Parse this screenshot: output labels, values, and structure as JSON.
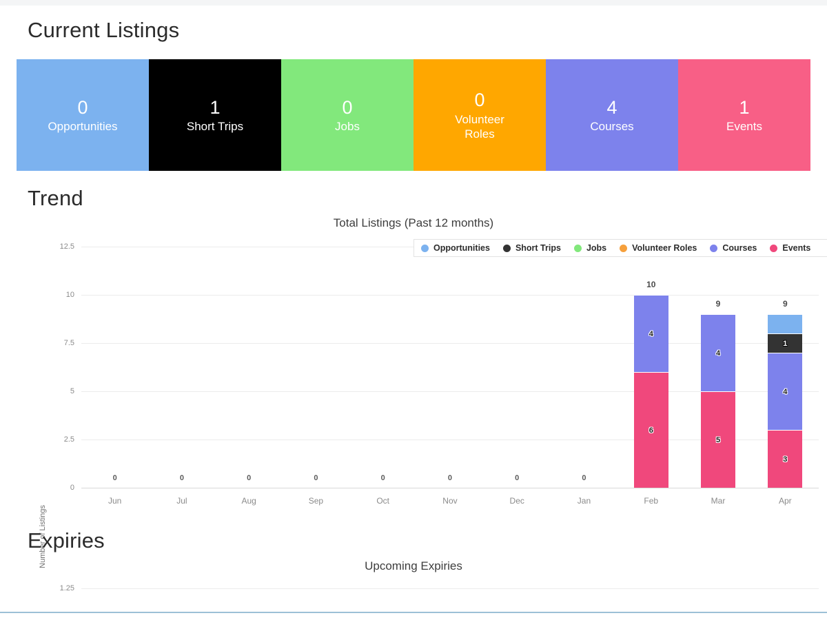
{
  "page": {
    "headings": {
      "current_listings": "Current Listings",
      "trend": "Trend",
      "expiries": "Expiries"
    }
  },
  "cards": [
    {
      "count": "0",
      "label": "Opportunities",
      "color": "#7cb2ef",
      "text_color": "#ffffff"
    },
    {
      "count": "1",
      "label": "Short Trips",
      "color": "#000000",
      "text_color": "#ffffff"
    },
    {
      "count": "0",
      "label": "Jobs",
      "color": "#82e87c",
      "text_color": "#ffffff"
    },
    {
      "count": "0",
      "label": "Volunteer Roles",
      "color": "#ffa700",
      "text_color": "#ffffff"
    },
    {
      "count": "4",
      "label": "Courses",
      "color": "#7d82ec",
      "text_color": "#ffffff"
    },
    {
      "count": "1",
      "label": "Events",
      "color": "#f85f86",
      "text_color": "#ffffff"
    }
  ],
  "legend": {
    "items": [
      {
        "label": "Opportunities",
        "color": "#7cb2ef"
      },
      {
        "label": "Short Trips",
        "color": "#333333"
      },
      {
        "label": "Jobs",
        "color": "#82e87c"
      },
      {
        "label": "Volunteer Roles",
        "color": "#f6a03c"
      },
      {
        "label": "Courses",
        "color": "#7d82ec"
      },
      {
        "label": "Events",
        "color": "#f0487c"
      }
    ],
    "clipped_note": "Events entry clipped at right edge"
  },
  "chart_data": [
    {
      "type": "bar",
      "id": "total-listings",
      "title": "Total Listings (Past 12 months)",
      "stacked": true,
      "xlabel": "",
      "ylabel": "Number of Listings",
      "ylim": [
        0,
        12.5
      ],
      "yticks": [
        "0",
        "2.5",
        "5",
        "7.5",
        "10",
        "12.5"
      ],
      "ytick_values": [
        0,
        2.5,
        5,
        7.5,
        10,
        12.5
      ],
      "grid": true,
      "legend_position": "top-right",
      "categories": [
        "Jun",
        "Jul",
        "Aug",
        "Sep",
        "Oct",
        "Nov",
        "Dec",
        "Jan",
        "Feb",
        "Mar",
        "Apr"
      ],
      "totals": [
        "0",
        "0",
        "0",
        "0",
        "0",
        "0",
        "0",
        "0",
        "10",
        "9",
        "9"
      ],
      "series": [
        {
          "name": "Events",
          "color": "#f0487c",
          "values": [
            0,
            0,
            0,
            0,
            0,
            0,
            0,
            0,
            6,
            5,
            3
          ]
        },
        {
          "name": "Courses",
          "color": "#7d82ec",
          "values": [
            0,
            0,
            0,
            0,
            0,
            0,
            0,
            0,
            4,
            4,
            4
          ]
        },
        {
          "name": "Short Trips",
          "color": "#333333",
          "values": [
            0,
            0,
            0,
            0,
            0,
            0,
            0,
            0,
            0,
            0,
            1
          ]
        },
        {
          "name": "Opportunities",
          "color": "#7cb2ef",
          "values": [
            0,
            0,
            0,
            0,
            0,
            0,
            0,
            0,
            0,
            0,
            1
          ]
        },
        {
          "name": "Jobs",
          "color": "#82e87c",
          "values": [
            0,
            0,
            0,
            0,
            0,
            0,
            0,
            0,
            0,
            0,
            0
          ]
        },
        {
          "name": "Volunteer Roles",
          "color": "#f6a03c",
          "values": [
            0,
            0,
            0,
            0,
            0,
            0,
            0,
            0,
            0,
            0,
            0
          ]
        }
      ],
      "segment_labels": {
        "Feb": [
          {
            "series": "Events",
            "value": "6"
          },
          {
            "series": "Courses",
            "value": "4"
          }
        ],
        "Mar": [
          {
            "series": "Events",
            "value": "5"
          },
          {
            "series": "Courses",
            "value": "4"
          }
        ],
        "Apr": [
          {
            "series": "Events",
            "value": "3"
          },
          {
            "series": "Courses",
            "value": "4"
          },
          {
            "series": "Short Trips",
            "value": "1"
          }
        ]
      }
    },
    {
      "type": "bar",
      "id": "upcoming-expiries",
      "title": "Upcoming Expiries",
      "stacked": true,
      "xlabel": "",
      "ylabel": "",
      "ylim": [
        0,
        1.25
      ],
      "yticks": [
        "1.25"
      ],
      "categories": [],
      "values": [],
      "grid": true,
      "note": "chart cut off by viewport bottom"
    }
  ]
}
